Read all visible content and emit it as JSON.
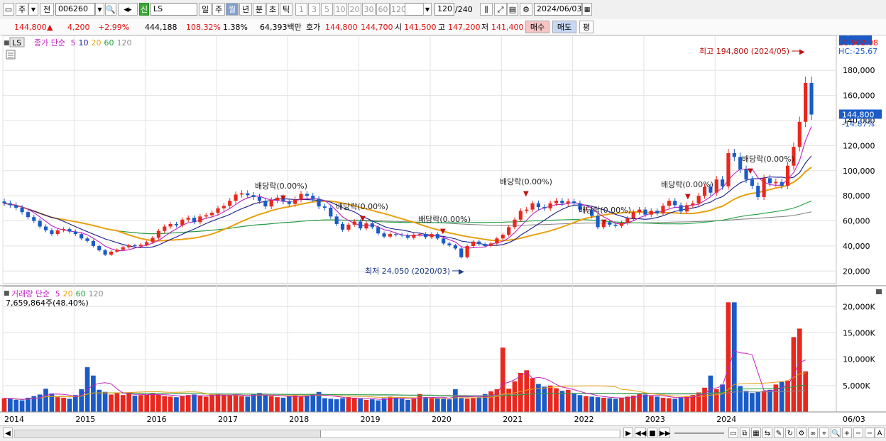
{
  "toolbar": {
    "period_label": "주",
    "prev_label": "전",
    "code": "006260",
    "badge": "신",
    "name": "LS",
    "intervals": [
      "일",
      "주",
      "월",
      "년",
      "분",
      "초",
      "틱"
    ],
    "selected_interval": "월",
    "numbers": [
      "1",
      "3",
      "5",
      "10",
      "20",
      "30",
      "60",
      "120"
    ],
    "count": "120",
    "count_total": "/240",
    "date": "2024/06/03"
  },
  "quote": {
    "price": "144,800",
    "direction": "▲",
    "change": "4,200",
    "change_pct": "+2.99%",
    "volume": "444,188",
    "vol_ratio": "108.32%",
    "turnover": "1.38%",
    "amount": "64,393백만",
    "ask_label": "호가",
    "ask1": "144,800",
    "ask2": "144,700",
    "open_label": "시",
    "open": "141,500",
    "high_label": "고",
    "high": "147,200",
    "low_label": "저",
    "low": "141,400",
    "buy_label": "매수",
    "sell_label": "매도",
    "eval_label": "평"
  },
  "colors": {
    "up": "#e8281e",
    "down": "#1a5bc8",
    "ma5": "#c020c0",
    "ma10": "#1a1a8a",
    "ma20": "#e8a010",
    "ma60": "#20a040",
    "ma120": "#8a8a8a"
  },
  "chart_data": {
    "type": "candlestick",
    "price_panel": {
      "legend": {
        "box": "LS",
        "name": "종가 단순",
        "periods": [
          "5",
          "10",
          "20",
          "60",
          "120"
        ]
      },
      "top_right_labels": [
        "LC:502.08",
        "HC:-25.67"
      ],
      "ylim": [
        10000,
        205000
      ],
      "y_ticks": [
        "20,000",
        "40,000",
        "60,000",
        "80,000",
        "100,000",
        "120,000",
        "140,000",
        "160,000",
        "180,000"
      ],
      "y_tick_values": [
        20000,
        40000,
        60000,
        80000,
        100000,
        120000,
        140000,
        160000,
        180000
      ],
      "current_price_label": "144,800",
      "current_pct_label": "-14.87%",
      "max_annotation": "최고 194,800 (2024/05)",
      "min_annotation": "최저 24,050 (2020/03)",
      "dividend_label": "배당락(0.00%)"
    },
    "volume_panel": {
      "legend": {
        "name": "거래량",
        "type": "단순",
        "periods": [
          "5",
          "20",
          "60",
          "120"
        ]
      },
      "subtitle": "7,659,864주(48.40%)",
      "ylim": [
        0,
        23000
      ],
      "y_ticks": [
        "5,000K",
        "10,000K",
        "15,000K",
        "20,000K"
      ],
      "y_tick_values": [
        5000,
        10000,
        15000,
        20000
      ],
      "current_label": "7,660K",
      "current_pct_label": "48.40%"
    },
    "x_ticks": [
      "2014",
      "2015",
      "2016",
      "2017",
      "2018",
      "2019",
      "2020",
      "2021",
      "2022",
      "2023",
      "2024",
      "06/03"
    ],
    "closes": [
      74000,
      72500,
      70500,
      67000,
      63000,
      60000,
      55500,
      52500,
      49500,
      52500,
      53500,
      51500,
      49500,
      46000,
      44000,
      40000,
      36500,
      33000,
      35500,
      37000,
      39000,
      40500,
      40000,
      41000,
      43000,
      46500,
      52000,
      55500,
      57500,
      56500,
      61000,
      62500,
      59000,
      63500,
      64500,
      66500,
      70000,
      72000,
      76000,
      81000,
      82000,
      80500,
      79000,
      76000,
      71500,
      76500,
      78500,
      75500,
      73500,
      77000,
      81500,
      80000,
      77500,
      71500,
      70500,
      63500,
      57500,
      53000,
      57000,
      59500,
      54000,
      58000,
      55000,
      50000,
      47500,
      49500,
      49000,
      48500,
      46500,
      49000,
      49500,
      47000,
      49500,
      46000,
      42000,
      40500,
      38000,
      31000,
      40000,
      43500,
      41500,
      40000,
      42000,
      46000,
      49000,
      55000,
      61000,
      68000,
      69000,
      74000,
      71000,
      70000,
      74000,
      76000,
      74000,
      75500,
      74000,
      69000,
      69000,
      64000,
      55000,
      59000,
      57000,
      56000,
      58500,
      62000,
      67000,
      69000,
      65000,
      68000,
      66000,
      72000,
      76000,
      72500,
      67500,
      72500,
      74000,
      80000,
      87000,
      82500,
      93000,
      87500,
      114000,
      111000,
      101000,
      93000,
      88000,
      79000,
      94000,
      90000,
      91000,
      88000,
      104000,
      119000,
      139000,
      170000,
      144800
    ],
    "volumes": [
      2600,
      2500,
      2300,
      2200,
      2700,
      3000,
      3300,
      4400,
      3500,
      2800,
      2700,
      2500,
      3200,
      4300,
      8500,
      6900,
      4200,
      3800,
      3300,
      3600,
      3200,
      3500,
      3100,
      3200,
      3300,
      3500,
      3300,
      3000,
      2900,
      2800,
      3000,
      3200,
      3300,
      3100,
      2900,
      3300,
      3400,
      3200,
      3100,
      3300,
      3000,
      2900,
      3400,
      3600,
      3100,
      3000,
      2800,
      2700,
      3000,
      3200,
      2900,
      3100,
      3400,
      3800,
      2600,
      2500,
      2400,
      2600,
      2800,
      2700,
      2500,
      2300,
      2400,
      2200,
      2600,
      2900,
      2700,
      2500,
      2300,
      2500,
      3400,
      2800,
      2700,
      2600,
      2500,
      2400,
      4300,
      2600,
      2500,
      2700,
      2800,
      3400,
      3900,
      4300,
      12200,
      4400,
      5800,
      7400,
      7900,
      6400,
      5300,
      4800,
      5000,
      4500,
      4000,
      4200,
      3500,
      3200,
      3000,
      2900,
      2800,
      2700,
      2600,
      2500,
      2700,
      2900,
      3100,
      3400,
      3300,
      3000,
      2900,
      2700,
      2600,
      2500,
      2800,
      3000,
      3200,
      3700,
      4600,
      6900,
      4300,
      5200,
      20800,
      20800,
      4900,
      4000,
      3600,
      3800,
      4000,
      4200,
      5200,
      5700,
      5900,
      14200,
      15800,
      7700
    ]
  },
  "status": {
    "bottom_icons": [
      "play-icon",
      "rewind-icon",
      "stop-icon",
      "forward-icon",
      "zoom-out-icon",
      "zoom-in-icon"
    ]
  }
}
